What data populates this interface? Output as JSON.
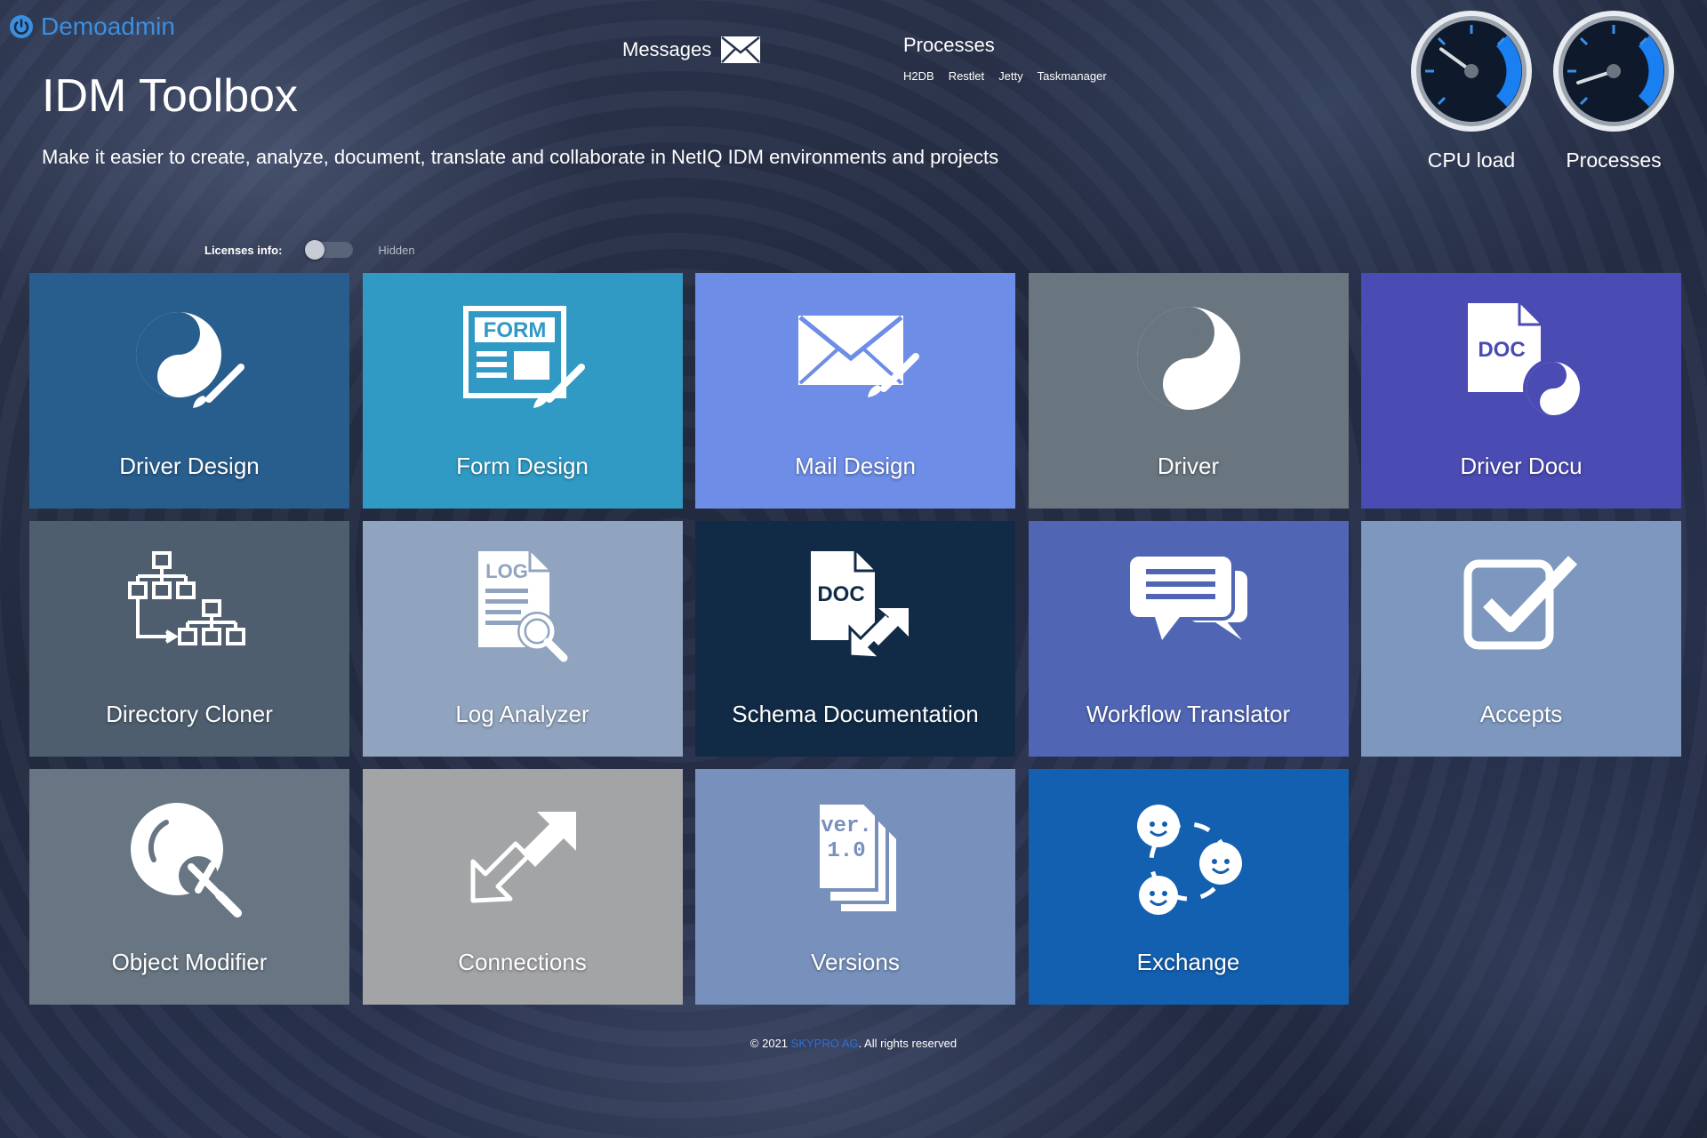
{
  "header": {
    "user_name": "Demoadmin",
    "app_title": "IDM Toolbox",
    "subtitle": "Make it easier to create, analyze, document, translate and collaborate in NetIQ IDM environments and projects",
    "messages_label": "Messages",
    "processes_title": "Processes",
    "process_links": [
      "H2DB",
      "Restlet",
      "Jetty",
      "Taskmanager"
    ]
  },
  "gauges": [
    {
      "label": "CPU load",
      "level": 0.3
    },
    {
      "label": "Processes",
      "level": 0.1
    }
  ],
  "license": {
    "label": "Licenses info:",
    "state": "Hidden",
    "enabled": false
  },
  "tiles": [
    {
      "label": "Driver Design",
      "icon": "yin-yang-brush-icon",
      "color": "#285e8e"
    },
    {
      "label": "Form Design",
      "icon": "form-brush-icon",
      "color": "#309ac4"
    },
    {
      "label": "Mail Design",
      "icon": "mail-brush-icon",
      "color": "#6d8de6"
    },
    {
      "label": "Driver",
      "icon": "yin-yang-icon",
      "color": "#69757f"
    },
    {
      "label": "Driver Docu",
      "icon": "doc-yin-yang-icon",
      "color": "#4a4bb3"
    },
    {
      "label": "Directory Cloner",
      "icon": "tree-copy-icon",
      "color": "#4e5e6f"
    },
    {
      "label": "Log Analyzer",
      "icon": "log-search-icon",
      "color": "#91a4bf"
    },
    {
      "label": "Schema Documentation",
      "icon": "doc-export-icon",
      "color": "#112b47"
    },
    {
      "label": "Workflow Translator",
      "icon": "chat-bubbles-icon",
      "color": "#5066b4"
    },
    {
      "label": "Accepts",
      "icon": "checkbox-icon",
      "color": "#7d97be"
    },
    {
      "label": "Object Modifier",
      "icon": "object-wrench-icon",
      "color": "#687683"
    },
    {
      "label": "Connections",
      "icon": "arrows-connect-icon",
      "color": "#a3a4a6"
    },
    {
      "label": "Versions",
      "icon": "versions-stack-icon",
      "color": "#7790bc"
    },
    {
      "label": "Exchange",
      "icon": "people-exchange-icon",
      "color": "#1360b0"
    }
  ],
  "footer": {
    "prefix": "© 2021 ",
    "company": "SKYPRO AG",
    "suffix": ". All rights reserved"
  }
}
